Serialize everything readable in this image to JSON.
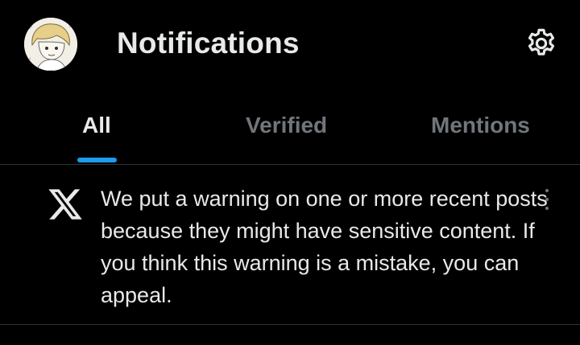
{
  "header": {
    "title": "Notifications",
    "avatar": "user-avatar",
    "settings_icon": "gear-icon"
  },
  "tabs": [
    {
      "label": "All",
      "active": true
    },
    {
      "label": "Verified",
      "active": false
    },
    {
      "label": "Mentions",
      "active": false
    }
  ],
  "notification": {
    "icon": "x-logo-icon",
    "text": "We put a warning on one or more recent posts because they might have sensitive content. If you think this warning is a mistake, you can appeal.",
    "more_icon": "more-options-icon"
  },
  "colors": {
    "background": "#000000",
    "text_primary": "#e7e9ea",
    "text_secondary": "#71767b",
    "accent": "#1d9bf0",
    "divider": "#2f3336"
  }
}
